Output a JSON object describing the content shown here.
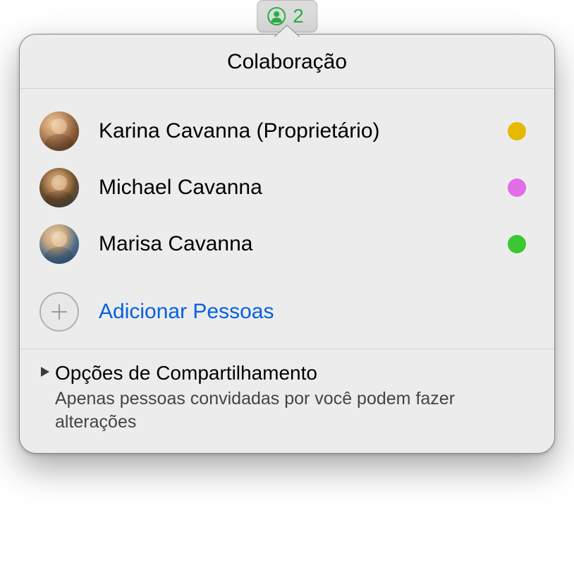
{
  "toolbar": {
    "participant_count": "2",
    "icon_color": "#2ab045"
  },
  "popover": {
    "title": "Colaboração",
    "participants": [
      {
        "name": "Karina Cavanna (Proprietário)",
        "status_color": "#e6b800"
      },
      {
        "name": "Michael Cavanna",
        "status_color": "#e36ce7"
      },
      {
        "name": "Marisa Cavanna",
        "status_color": "#3ac732"
      }
    ],
    "add_people_label": "Adicionar Pessoas",
    "share_options": {
      "title": "Opções de Compartilhamento",
      "subtitle": "Apenas pessoas convidadas por você podem fazer alterações"
    }
  }
}
